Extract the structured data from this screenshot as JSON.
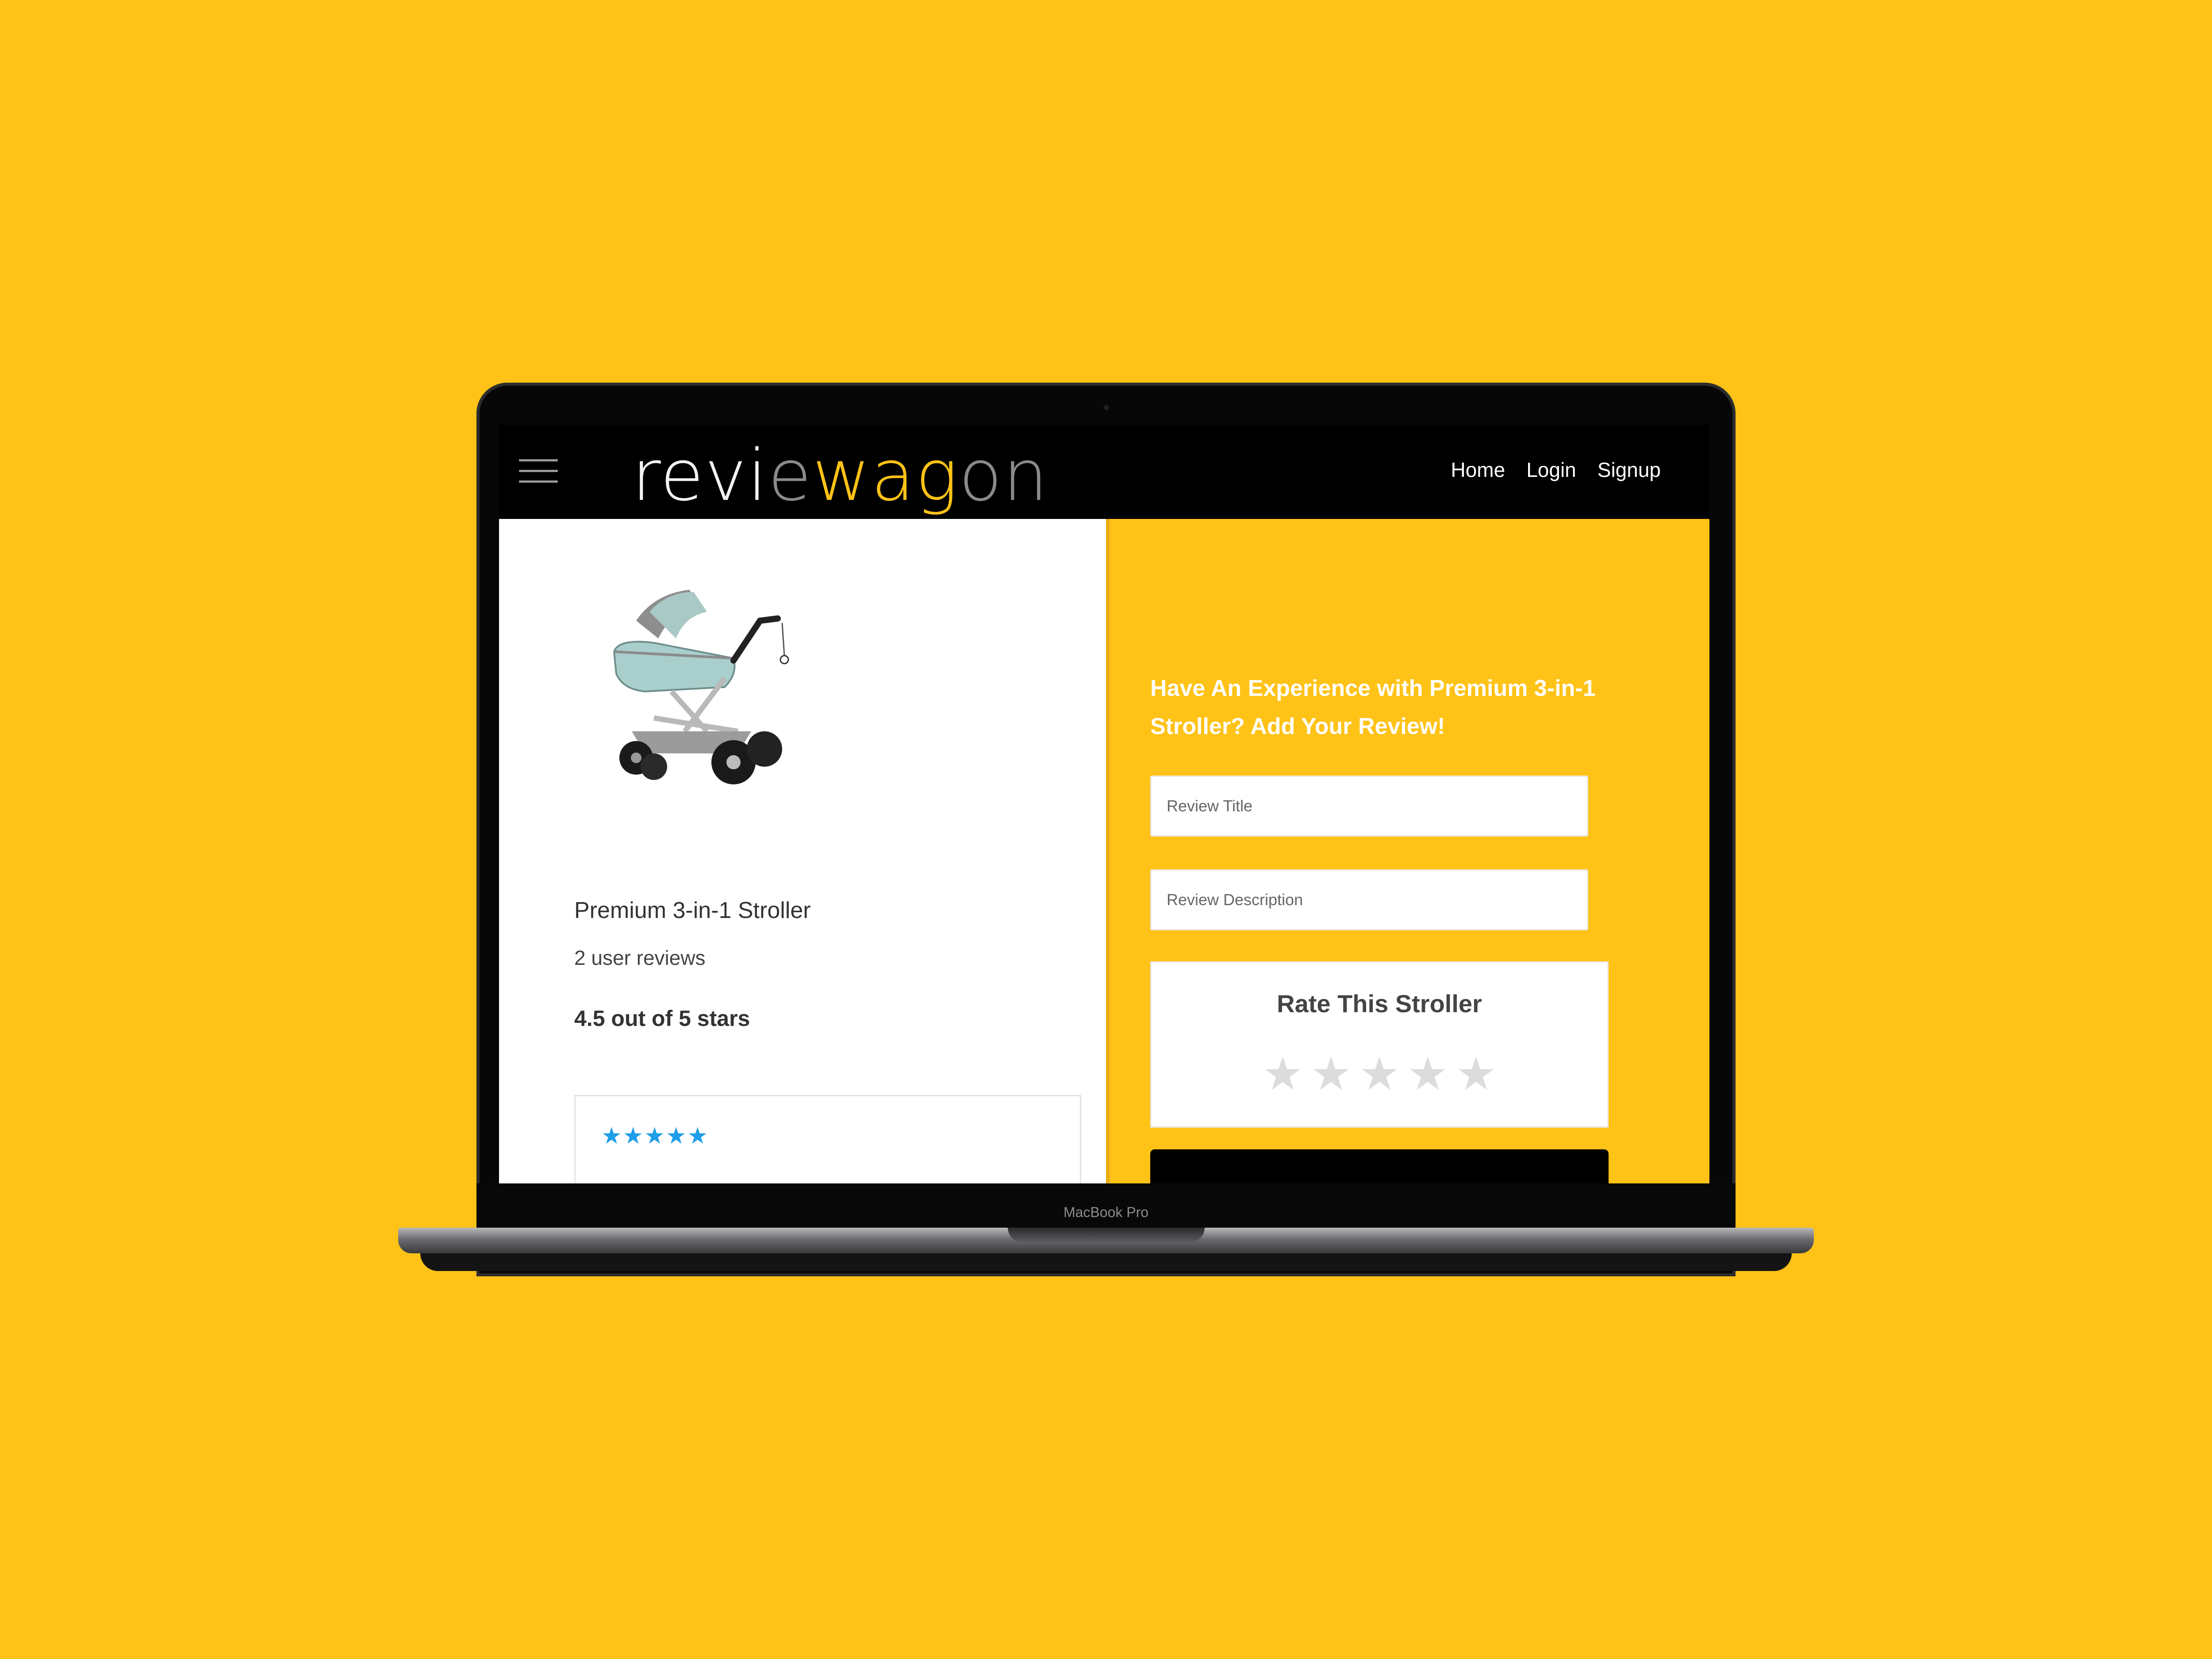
{
  "device": {
    "model_label": "MacBook Pro"
  },
  "header": {
    "logo_part1": "revi",
    "logo_part2": "e",
    "logo_part3": "wag",
    "logo_part4": "on",
    "nav": {
      "home": "Home",
      "login": "Login",
      "signup": "Signup"
    }
  },
  "product": {
    "name": "Premium 3-in-1 Stroller",
    "review_count": "2 user reviews",
    "rating_text": "4.5 out of 5 stars",
    "first_review_stars": "★★★★★",
    "first_review_rating": 5
  },
  "review_form": {
    "heading": "Have An Experience with Premium 3-in-1 Stroller? Add Your Review!",
    "title_placeholder": "Review Title",
    "description_placeholder": "Review Description",
    "rate_title": "Rate This Stroller",
    "rating_selected": 0
  },
  "colors": {
    "brand_yellow": "#FFC217",
    "header_bg": "#000000",
    "review_star": "#1E9EE8",
    "empty_star": "#DCDCDC"
  }
}
